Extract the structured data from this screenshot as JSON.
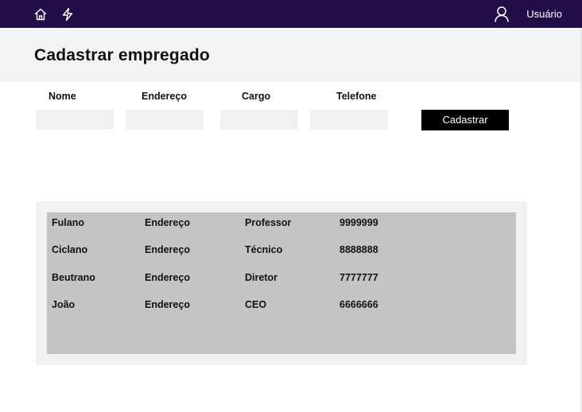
{
  "header": {
    "user_label": "Usuário",
    "icons": [
      "home-icon",
      "lightning-icon",
      "user-icon"
    ],
    "background_color": "#230d48"
  },
  "page": {
    "title": "Cadastrar empregado"
  },
  "form": {
    "fields": [
      {
        "label": "Nome",
        "value": ""
      },
      {
        "label": "Endereço",
        "value": ""
      },
      {
        "label": "Cargo",
        "value": ""
      },
      {
        "label": "Telefone",
        "value": ""
      }
    ],
    "submit_label": "Cadastrar"
  },
  "table": {
    "rows": [
      [
        "Fulano",
        "Endereço",
        "Professor",
        "9999999"
      ],
      [
        "Ciclano",
        "Endereço",
        "Técnico",
        "8888888"
      ],
      [
        "Beutrano",
        "Endereço",
        "Diretor",
        "7777777"
      ],
      [
        "João",
        "Endereço",
        "CEO",
        "6666666"
      ]
    ]
  }
}
